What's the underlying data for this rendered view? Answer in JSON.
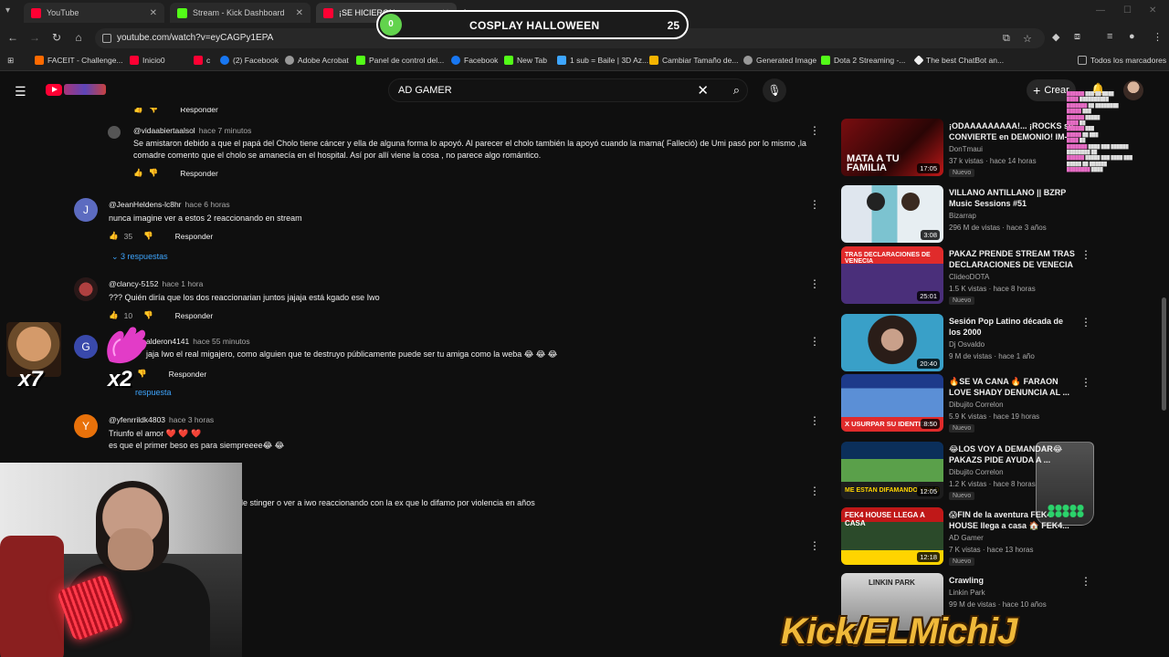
{
  "browser": {
    "tabs": [
      {
        "title": "YouTube"
      },
      {
        "title": "Stream - Kick Dashboard"
      },
      {
        "title": "¡SE HICIERON"
      }
    ],
    "url": "youtube.com/watch?v=eyCAGPy1EPA",
    "bookmarks": [
      "FACEIT - Challenge...",
      "Inicio0",
      "c",
      "(2) Facebook",
      "Adobe Acrobat",
      "Panel de control del...",
      "Facebook",
      "New Tab",
      "1 sub = Baile | 3D Az...",
      "Cambiar Tamaño de...",
      "Generated Image",
      "Dota 2 Streaming -...",
      "The best ChatBot an...",
      "Todos los marcadores"
    ]
  },
  "youtube": {
    "search_query": "AD GAMER",
    "create_label": "Crear"
  },
  "stream_goal": {
    "label": "COSPLAY HALLOWEEN",
    "current": "0",
    "target": "25"
  },
  "overlays": {
    "emote1_count": "x7",
    "emote2_count": "x2",
    "brand": "Kick/ELMichiJ"
  },
  "comments": [
    {
      "author": "@vidaabiertaalsol",
      "time": "hace 7 minutos",
      "text": "Se amistaron debido a que el papá del Cholo  tiene cáncer y ella de alguna forma lo apoyó. Al parecer el cholo también la apoyó cuando la mama( Falleció) de Umi pasó por lo mismo ,la comadre comento que el cholo se amanecía en el hospital. Así por allí viene la cosa , no parece algo romántico.",
      "likes": "",
      "reply_label": "Responder"
    },
    {
      "author": "@JeanHeldens-lc8hr",
      "time": "hace 6 horas",
      "text": "nunca imagine ver a estos 2 reaccionando  en stream",
      "likes": "35",
      "reply_label": "Responder",
      "replies": "3 respuestas"
    },
    {
      "author": "@clancy-5152",
      "time": "hace 1 hora",
      "text": "??? Quién diría que los dos reaccionarian juntos jajaja está kgado ese Iwo",
      "likes": "10",
      "reply_label": "Responder"
    },
    {
      "author": "alderon4141",
      "time": "hace 55 minutos",
      "text": "jaja Iwo el real migajero, como alguien que te destruyo públicamente puede ser tu amiga como la weba 😂 😂 😂",
      "likes": "",
      "reply_label": "Responder",
      "replies": "respuesta"
    },
    {
      "author": "@yfenrrildk4803",
      "time": "hace 3 horas",
      "text": "Triunfo el amor ❤️ ❤️ ❤️",
      "text2": "es que el primer beso es para siempreeee😂 😂",
      "likes": "",
      "reply_label": ""
    },
    {
      "author": "",
      "time": "",
      "text": "le stinger o ver a iwo reaccionando con la ex que lo difamo por violencia  en años",
      "likes": "",
      "reply_label": ""
    }
  ],
  "recommendations": [
    {
      "title": "¡ODAAAAAAAAA!... ¡ROCKS se CONVIERTE en DEMONIO! IM-...",
      "channel": "DonTmaui",
      "meta": "37 k vistas · hace 14 horas",
      "badge": "Nuevo",
      "duration": "17:05",
      "thumb_text": "MATA A TU FAMILIA"
    },
    {
      "title": "VILLANO ANTILLANO || BZRP Music Sessions #51",
      "channel": "Bizarrap",
      "meta": "296 M de vistas · hace 3 años",
      "badge": "",
      "duration": "3:08",
      "thumb_text": ""
    },
    {
      "title": "PAKAZ PRENDE STREAM TRAS DECLARACIONES DE VENECIA",
      "channel": "ClideoDOTA",
      "meta": "1.5 K vistas · hace 8 horas",
      "badge": "Nuevo",
      "duration": "25:01",
      "thumb_text": "TRAS DECLARACIONES DE VENECIA"
    },
    {
      "title": "Sesión Pop Latino década de los 2000",
      "channel": "Dj Osvaldo",
      "meta": "9 M de vistas · hace 1 año",
      "badge": "",
      "duration": "20:40",
      "thumb_text": ""
    },
    {
      "title": "🔥SE VA CANA 🔥 FARAON LOVE SHADY DENUNCIA AL ...",
      "channel": "Dibujito Correlon",
      "meta": "5.9 K vistas · hace 19 horas",
      "badge": "Nuevo",
      "duration": "8:50",
      "thumb_text": "X USURPAR SU IDENTIDAD"
    },
    {
      "title": "😂LOS VOY A DEMANDAR😂 PAKAZS PIDE AYUDA A ...",
      "channel": "Dibujito Correlon",
      "meta": "1.2 K vistas · hace 8 horas",
      "badge": "Nuevo",
      "duration": "12:05",
      "thumb_text": "ME ESTAN DIFAMANDO VOY D"
    },
    {
      "title": "😱FIN de la aventura FEK4 HOUSE llega a casa 🏠 FEK4...",
      "channel": "AD Gamer",
      "meta": "7 K vistas · hace 13 horas",
      "badge": "Nuevo",
      "duration": "12:18",
      "thumb_text": "FEK4 HOUSE LLEGA A CASA"
    },
    {
      "title": "Crawling",
      "channel": "Linkin Park",
      "meta": "99 M de vistas · hace 10 años",
      "badge": "",
      "duration": "",
      "thumb_text": "LINKIN PARK"
    }
  ],
  "colors": {
    "background": "#0f0f0f",
    "accent_blue": "#3ea6ff",
    "youtube_red": "#ff0033",
    "kick_green": "#53fc18",
    "goal_fill": "#62d34d",
    "brand_gold": "#f0b93a"
  }
}
